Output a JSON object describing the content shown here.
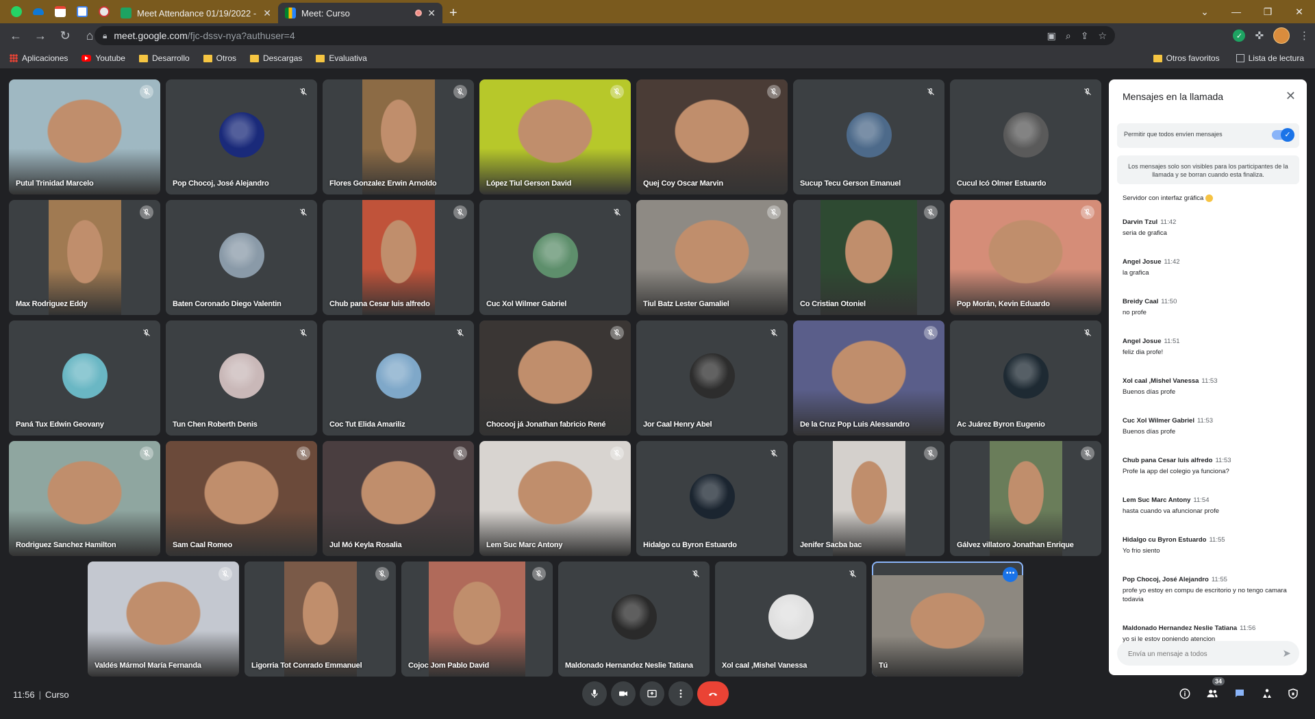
{
  "browser": {
    "tabs": [
      {
        "title": "Meet Attendance 01/19/2022 - i",
        "favicon_color": "#1ea362",
        "active": false
      },
      {
        "title": "Meet: Curso",
        "favicon_color": "#fbbc04",
        "active": true
      }
    ],
    "pinned_icons": [
      "whatsapp-icon",
      "onedrive-icon",
      "gmail-icon",
      "calendar-icon",
      "extension-icon"
    ],
    "url_host": "meet.google.com",
    "url_path": "/fjc-dssv-nya?authuser=4",
    "bookmarks": [
      "Aplicaciones",
      "Youtube",
      "Desarrollo",
      "Otros",
      "Descargas",
      "Evaluativa"
    ],
    "bookmarks_right": [
      "Otros favoritos",
      "Lista de lectura"
    ]
  },
  "participants": [
    {
      "name": "Putul Trinidad Marcelo",
      "kind": "video",
      "bg": "#9fb8c2",
      "sw": 1.0
    },
    {
      "name": "Pop Chocoj, José Alejandro",
      "kind": "avatar",
      "bg": "#1a2a7a"
    },
    {
      "name": "Flores Gonzalez Erwin Arnoldo",
      "kind": "video",
      "bg": "#8c6b45",
      "sw": 0.48
    },
    {
      "name": "López Tiul Gerson David",
      "kind": "video",
      "bg": "#b7c82a",
      "sw": 1.0
    },
    {
      "name": "Quej Coy Oscar Marvin",
      "kind": "video",
      "bg": "#4a3c36",
      "sw": 1.0
    },
    {
      "name": "Sucup Tecu Gerson Emanuel",
      "kind": "avatar",
      "bg": "#4d6a8a"
    },
    {
      "name": "Cucul Icó Olmer Estuardo",
      "kind": "avatar",
      "bg": "#5a5a5a"
    },
    {
      "name": "Max Rodriguez Eddy",
      "kind": "video",
      "bg": "#a07a52",
      "sw": 0.48
    },
    {
      "name": "Baten Coronado Diego Valentin",
      "kind": "avatar",
      "bg": "#8a9aa8"
    },
    {
      "name": "Chub pana Cesar luis alfredo",
      "kind": "video",
      "bg": "#c0533a",
      "sw": 0.48
    },
    {
      "name": "Cuc Xol Wilmer Gabriel",
      "kind": "avatar",
      "bg": "#5e8f6c"
    },
    {
      "name": "Tiul Batz Lester Gamaliel",
      "kind": "video",
      "bg": "#8e8a84",
      "sw": 1.0
    },
    {
      "name": "Co Cristian Otoniel",
      "kind": "video",
      "bg": "#2e4a32",
      "sw": 0.64
    },
    {
      "name": "Pop Morán, Kevin Eduardo",
      "kind": "video",
      "bg": "#d58d78",
      "sw": 1.0
    },
    {
      "name": "Paná Tux Edwin Geovany",
      "kind": "avatar",
      "bg": "#6ab7c4"
    },
    {
      "name": "Tun Chen Roberth Denis",
      "kind": "avatar",
      "bg": "#c9b8b8"
    },
    {
      "name": "Coc Tut Elida Amariliz",
      "kind": "avatar",
      "bg": "#7fa8c9"
    },
    {
      "name": "Chocooj já Jonathan fabricio René",
      "kind": "video",
      "bg": "#3a3634",
      "sw": 1.0
    },
    {
      "name": "Jor Caal Henry Abel",
      "kind": "avatar",
      "bg": "#2d2d2d"
    },
    {
      "name": "De la Cruz Pop Luis Alessandro",
      "kind": "video",
      "bg": "#5a5e8a",
      "sw": 1.0
    },
    {
      "name": "Ac Juárez Byron Eugenio",
      "kind": "avatar",
      "bg": "#1e2a33"
    },
    {
      "name": "Rodriguez Sanchez Hamilton",
      "kind": "video",
      "bg": "#8fa6a0",
      "sw": 1.0
    },
    {
      "name": "Sam Caal Romeo",
      "kind": "video",
      "bg": "#6b4a3a",
      "sw": 1.0
    },
    {
      "name": "Jul Mó Keyla Rosalia",
      "kind": "video",
      "bg": "#4a3e40",
      "sw": 1.0
    },
    {
      "name": "Lem Suc Marc Antony",
      "kind": "video",
      "bg": "#d8d4d0",
      "sw": 1.0
    },
    {
      "name": "Hidalgo cu Byron Estuardo",
      "kind": "avatar",
      "bg": "#1b2530"
    },
    {
      "name": "Jenifer Sacba bac",
      "kind": "video",
      "bg": "#d4d0cc",
      "sw": 0.48
    },
    {
      "name": "Gálvez villatoro Jonathan Enrique",
      "kind": "video",
      "bg": "#6a7d5a",
      "sw": 0.48
    },
    {
      "name": "Valdés Mármol María Fernanda",
      "kind": "video",
      "bg": "#c4c8d0",
      "sw": 1.0
    },
    {
      "name": "Ligorria Tot Conrado Emmanuel",
      "kind": "video",
      "bg": "#7a5a48",
      "sw": 0.48
    },
    {
      "name": "Cojoc Jom Pablo David",
      "kind": "video",
      "bg": "#b06a5a",
      "sw": 0.64
    },
    {
      "name": "Maldonado Hernandez Neslie Tatiana",
      "kind": "avatar",
      "bg": "#2a2a2a"
    },
    {
      "name": "Xol caal ,Mishel Vanessa",
      "kind": "avatar",
      "bg": "#e0e0e0"
    },
    {
      "name": "Tú",
      "kind": "video",
      "bg": "#8d8880",
      "sw": 1.0,
      "you": true
    }
  ],
  "chat": {
    "title": "Mensajes en la llamada",
    "toggle_label": "Permitir que todos envíen mensajes",
    "info": "Los mensajes solo son visibles para los participantes de la llamada y se borran cuando esta finaliza.",
    "first_message": "Servidor con interfaz gráfica",
    "messages": [
      {
        "sender": "Darvin Tzul",
        "time": "11:42",
        "text": "seria de grafica"
      },
      {
        "sender": "Angel Josue",
        "time": "11:42",
        "text": "la grafica"
      },
      {
        "sender": "Breidy Caal",
        "time": "11:50",
        "text": "no profe"
      },
      {
        "sender": "Angel Josue",
        "time": "11:51",
        "text": "feliz dia profe!"
      },
      {
        "sender": "Xol caal ,Mishel Vanessa",
        "time": "11:53",
        "text": "Buenos días profe"
      },
      {
        "sender": "Cuc Xol Wilmer Gabriel",
        "time": "11:53",
        "text": "Buenos días profe"
      },
      {
        "sender": "Chub pana Cesar luis alfredo",
        "time": "11:53",
        "text": "Profe la app del colegio ya funciona?"
      },
      {
        "sender": "Lem Suc Marc Antony",
        "time": "11:54",
        "text": "hasta cuando va afuncionar profe"
      },
      {
        "sender": "Hidalgo cu Byron Estuardo",
        "time": "11:55",
        "text": "Yo frio siento"
      },
      {
        "sender": "Pop Chocoj, José Alejandro",
        "time": "11:55",
        "text": "profe yo estoy en compu de escritorio y no tengo camara todavia"
      },
      {
        "sender": "Maldonado Hernandez Neslie Tatiana",
        "time": "11:56",
        "text": "yo si le estoy poniendo atencion"
      }
    ],
    "input_placeholder": "Envía un mensaje a todos"
  },
  "bottom": {
    "time": "11:56",
    "meeting_name": "Curso",
    "participant_count": "34"
  },
  "colors": {
    "tabstrip": "#7a5a1e",
    "hangup": "#ea4335",
    "accent": "#1a73e8"
  }
}
